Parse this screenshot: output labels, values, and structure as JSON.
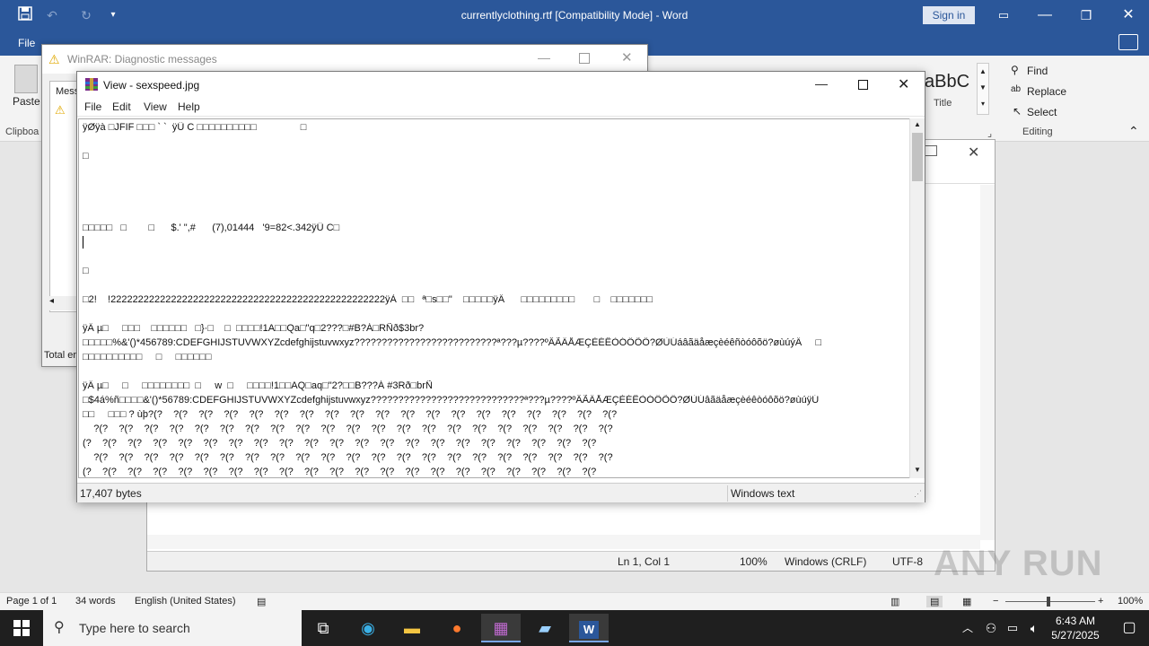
{
  "word": {
    "title": "currentlyclothing.rtf [Compatibility Mode]  -  Word",
    "sign_in": "Sign in",
    "file_tab": "File",
    "ribbon": {
      "paste": "Paste",
      "clipboard": "Clipboa",
      "style_sample": "aBbC",
      "style_title": "Title",
      "find": "Find",
      "replace": "Replace",
      "select": "Select",
      "editing": "Editing"
    },
    "status": {
      "page": "Page 1 of 1",
      "words": "34 words",
      "language": "English (United States)",
      "zoom": "100%"
    }
  },
  "bg_window": {
    "status_pos": "Ln 1, Col 1",
    "status_zoom": "100%",
    "status_eol": "Windows (CRLF)",
    "status_enc": "UTF-8"
  },
  "winrar": {
    "title": "WinRAR: Diagnostic messages",
    "col_label": "Mess",
    "total_label": "Total er"
  },
  "view": {
    "title": "View - sexspeed.jpg",
    "menu": [
      "File",
      "Edit",
      "View",
      "Help"
    ],
    "lines": [
      "ÿØÿà □JFIF □□□ ` `  ÿÛ C □□□□□□□□□□                □",
      "□",
      "",
      "",
      "",
      "□□□□□   □        □      $.' \",#      (7),01444   '9=82<.342ÿÛ C□",
      "",
      "□",
      "",
      "□2!    !22222222222222222222222222222222222222222222222222ÿÀ  □□   ª□s□□\"    □□□□□ÿÄ      □□□□□□□□□       □    □□□□□□□",
      "",
      "ÿÄ µ□     □□□    □□□□□□   □}·□    □  □□□□!1A□□Qa□\"q□2???□#B?Á□RÑð$3br?",
      "□□□□□%&'()*456789:CDEFGHIJSTUVWXYZcdefghijstuvwxyz??????????????????????????ª???µ????ºÂÃÄÅÆÇÈÉÊÒÓÔÕÖ?ØÙÚáâãäåæçèéêñòóôõö?øùúýÄ     □",
      "□□□□□□□□□□     □     □□□□□□",
      "",
      "ÿÄ µ□     □     □□□□□□□□  □     w  □     □□□□!1□□AQ□aq□\"2?□□B???Á #3Rð□brÑ",
      "□$4á%ñ□□□□&'()*56789:CDEFGHIJSTUVWXYZcdefghijstuvwxyz????????????????????????????ª???µ????ºÂÃÄÅÆÇÈÉÊÒÓÔÕÖ?ØÙÚâãäåæçèéêòóôõö?øùúÿÚ",
      "□□     □□□ ? ùþ?(?    ?(?    ?(?    ?(?    ?(?    ?(?    ?(?    ?(?    ?(?    ?(?    ?(?    ?(?    ?(?    ?(?    ?(?    ?(?    ?(?    ?(?    ?(?",
      "    ?(?    ?(?    ?(?    ?(?    ?(?    ?(?    ?(?    ?(?    ?(?    ?(?    ?(?    ?(?    ?(?    ?(?    ?(?    ?(?    ?(?    ?(?    ?(?    ?(?    ?(?",
      "(?    ?(?    ?(?    ?(?    ?(?    ?(?    ?(?    ?(?    ?(?    ?(?    ?(?    ?(?    ?(?    ?(?    ?(?    ?(?    ?(?    ?(?    ?(?    ?(?    ?(?",
      "    ?(?    ?(?    ?(?    ?(?    ?(?    ?(?    ?(?    ?(?    ?(?    ?(?    ?(?    ?(?    ?(?    ?(?    ?(?    ?(?    ?(?    ?(?    ?(?    ?(?    ?(?",
      "(?    ?(?    ?(?    ?(?    ?(?    ?(?    ?(?    ?(?    ?(?    ?(?    ?(?    ?(?    ?(?    ?(?    ?(?    ?(?    ?(?    ?(?    ?(?    ?(?    ?(?"
    ],
    "status_size": "17,407 bytes",
    "status_encoding": "Windows text"
  },
  "taskbar": {
    "search_placeholder": "Type here to search",
    "time": "6:43 AM",
    "date": "5/27/2025"
  },
  "watermark": "ANY RUN"
}
